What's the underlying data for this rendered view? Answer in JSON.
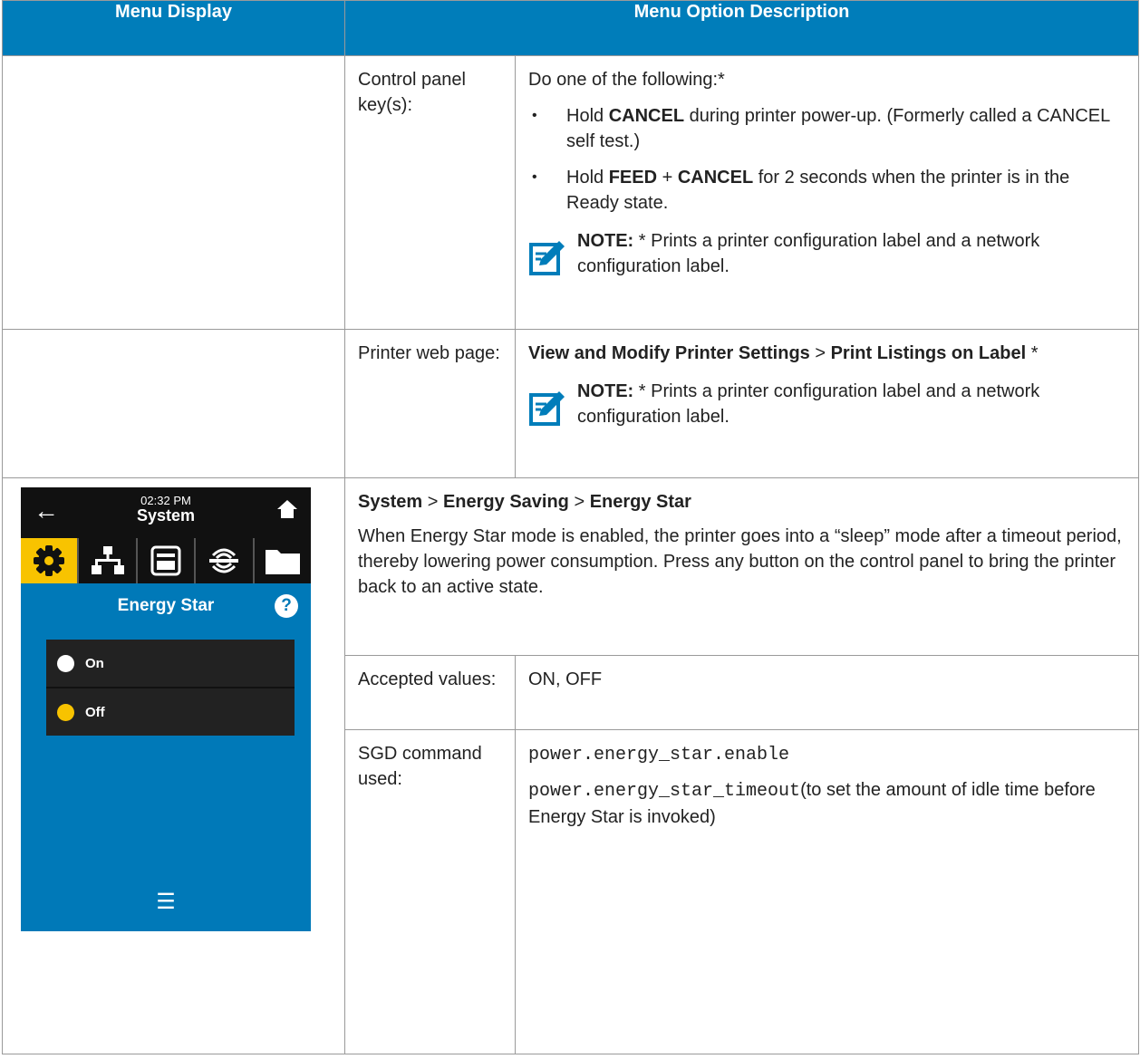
{
  "header": {
    "col1": "Menu Display",
    "col2": "Menu Option Description"
  },
  "row1": {
    "label": "Control panel key(s):",
    "intro": "Do one of the following:*",
    "bullets": [
      {
        "pre": "Hold ",
        "b1": "CANCEL",
        "mid": " during printer power-up. (Formerly called a CANCEL self test.)",
        "b2": "",
        "post": ""
      },
      {
        "pre": "Hold ",
        "b1": "FEED",
        "mid": " + ",
        "b2": "CANCEL",
        "post": " for 2 seconds when the printer is in the Ready state."
      }
    ],
    "note": {
      "label": "NOTE:",
      "text": " * Prints a printer configuration label and a network configuration label."
    }
  },
  "row2": {
    "label": "Printer web page:",
    "path_a": "View and Modify Printer Settings",
    "sep": " > ",
    "path_b": "Print Listings on Label",
    "suffix": " *",
    "note": {
      "label": "NOTE:",
      "text": " * Prints a printer configuration label and a network configuration label."
    }
  },
  "row3": {
    "path": [
      "System",
      "Energy Saving",
      "Energy Star"
    ],
    "sep": " > ",
    "description": "When Energy Star mode is enabled, the printer goes into a “sleep” mode after a timeout period, thereby lowering power consumption. Press any button on the control panel to bring the printer back to an active state.",
    "accepted_label": "Accepted values:",
    "accepted_values": "ON, OFF",
    "sgd_label": "SGD command used:",
    "sgd_cmd1": "power.energy_star.enable",
    "sgd_cmd2": "power.energy_star_timeout",
    "sgd_cmd2_desc": "(to set the amount of idle time before Energy Star is invoked)"
  },
  "screen": {
    "time": "02:32 PM",
    "title": "System",
    "section": "Energy Star",
    "help": "?",
    "options": [
      {
        "label": "On",
        "color": "#ffffff"
      },
      {
        "label": "Off",
        "color": "#f8c300"
      }
    ],
    "tabs": [
      "gear-icon",
      "network-icon",
      "printer-icon",
      "rfid-icon",
      "folder-icon"
    ],
    "colors": {
      "screen_bg": "#0079b8",
      "active_tab": "#f8c300",
      "header_bg": "#007dba"
    }
  }
}
